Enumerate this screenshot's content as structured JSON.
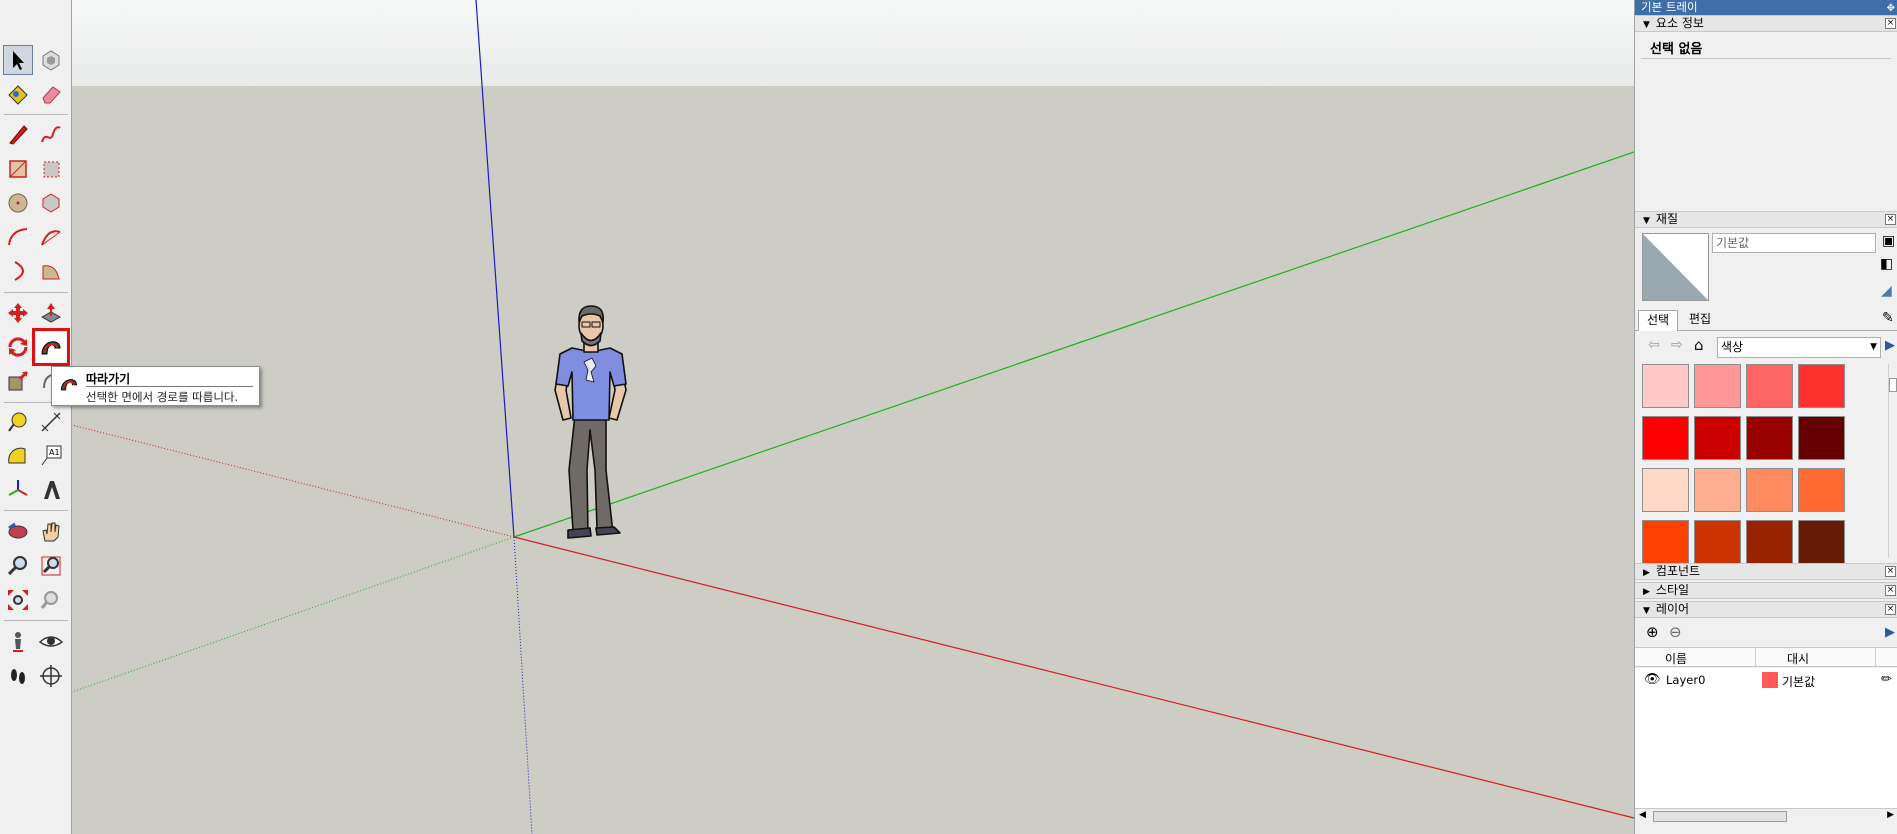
{
  "toolbar": {
    "tooltip": {
      "title": "따라가기",
      "description": "선택한 면에서 경로를 따릅니다."
    }
  },
  "tray": {
    "title": "기본 트레이",
    "entity_info": {
      "header": "요소 정보",
      "status": "선택 없음"
    },
    "materials": {
      "header": "재질",
      "name_value": "기본값",
      "tab_select": "선택",
      "tab_edit": "편집",
      "library": "색상",
      "swatches": [
        "#ffc9c9",
        "#ff9797",
        "#ff6565",
        "#ff3030",
        "#ff0000",
        "#cc0000",
        "#990000",
        "#660000",
        "#ffd8c8",
        "#ffad90",
        "#ff8a5e",
        "#ff6a33",
        "#ff4000",
        "#cc3300",
        "#992200",
        "#661a08"
      ]
    },
    "components": {
      "header": "컴포넌트"
    },
    "styles": {
      "header": "스타일"
    },
    "layers": {
      "header": "레이어",
      "col_name": "이름",
      "col_dash": "대시",
      "rows": [
        {
          "name": "Layer0",
          "color": "#ff5a5a",
          "dash": "기본값"
        }
      ]
    }
  },
  "colors": {
    "axis_red": "#d02020",
    "axis_green": "#20b020",
    "axis_blue": "#1c1cc0",
    "sky": "#eef0f0",
    "ground": "#cdcdc6",
    "highlight": "#e01010",
    "tray_title": "#3e6ea8"
  }
}
